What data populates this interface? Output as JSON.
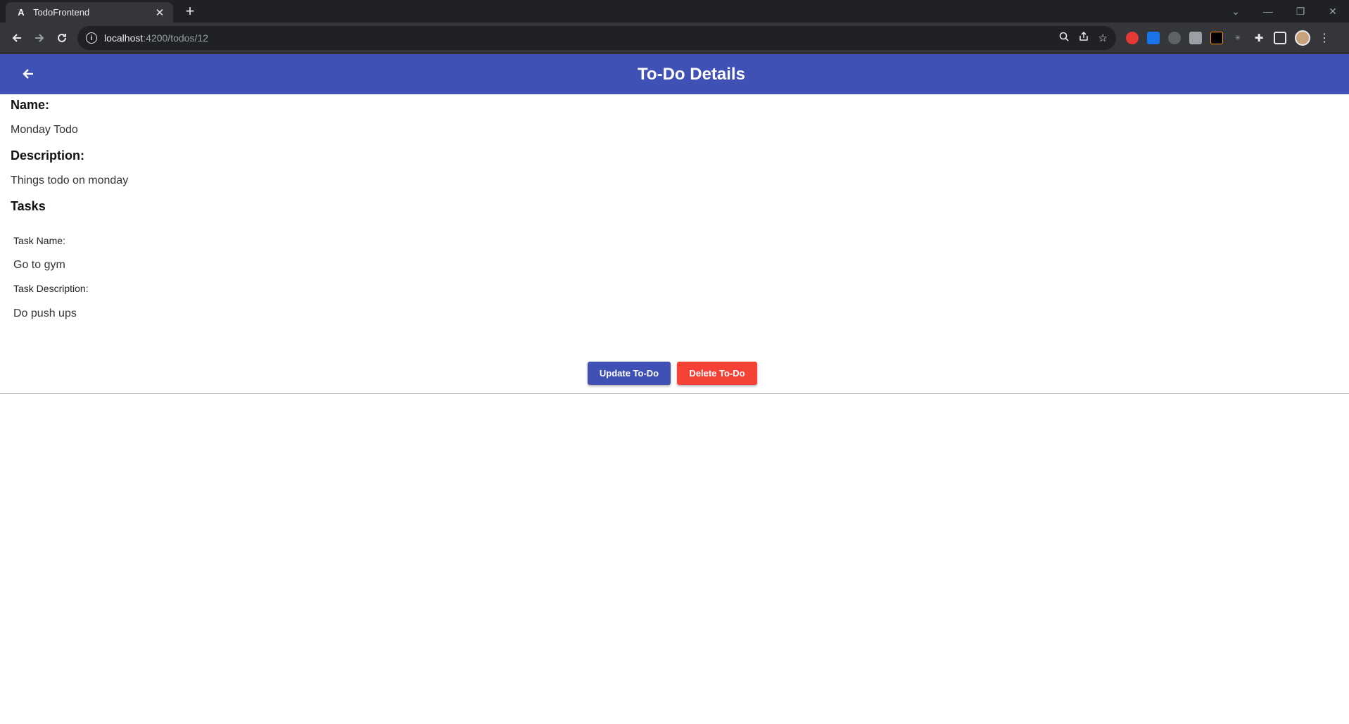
{
  "browser": {
    "tab_title": "TodoFrontend",
    "tab_favicon": "A",
    "url_host": "localhost",
    "url_path": ":4200/todos/12"
  },
  "header": {
    "title": "To-Do Details",
    "color": "#3f51b5"
  },
  "todo": {
    "name_label": "Name:",
    "name": "Monday Todo",
    "description_label": "Description:",
    "description": "Things todo on monday",
    "tasks_label": "Tasks",
    "tasks": [
      {
        "name_label": "Task Name:",
        "name": "Go to gym",
        "description_label": "Task Description:",
        "description": "Do push ups"
      }
    ]
  },
  "actions": {
    "update_label": "Update To-Do",
    "delete_label": "Delete To-Do",
    "update_color": "#3f51b5",
    "delete_color": "#f44336"
  }
}
